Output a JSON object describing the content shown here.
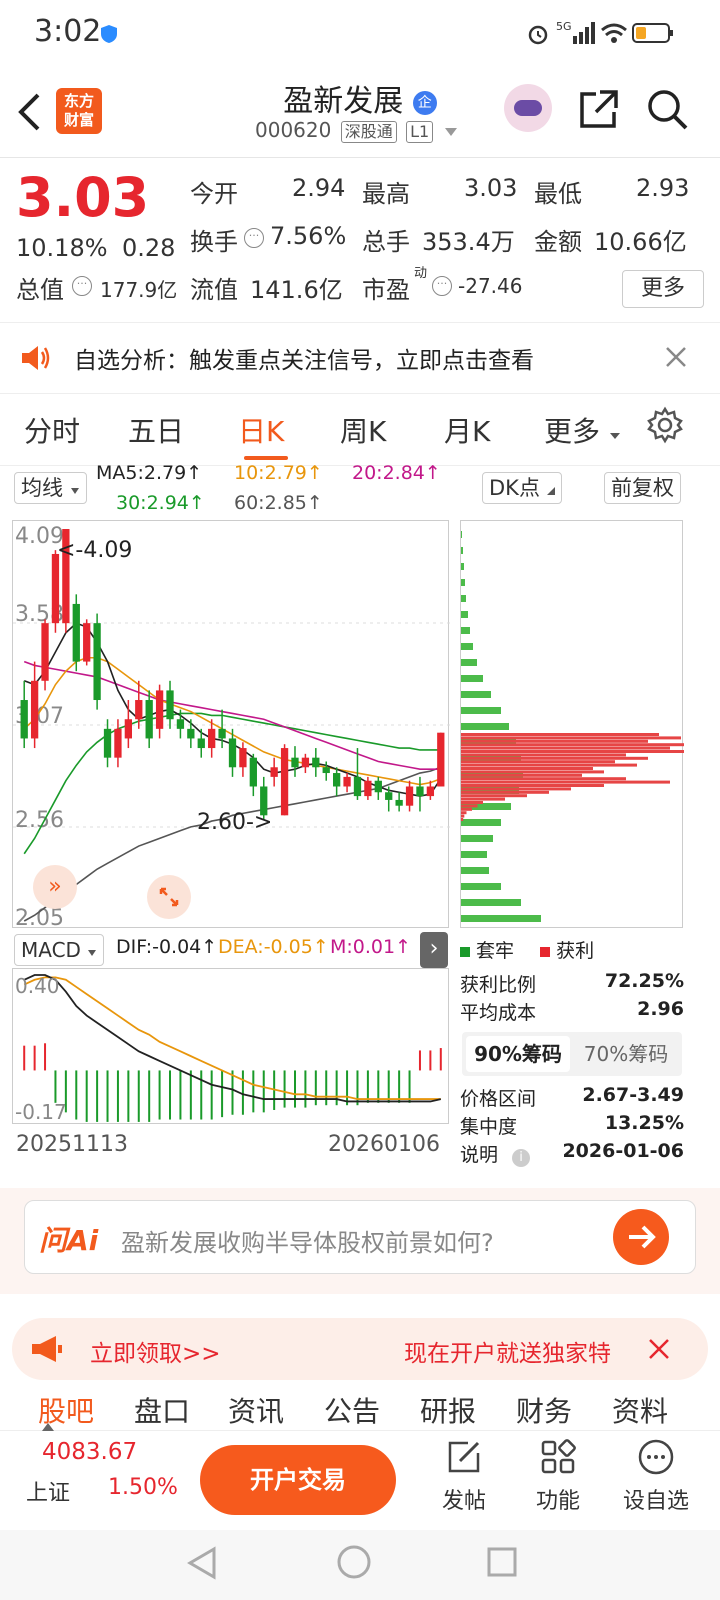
{
  "status": {
    "time": "3:02",
    "network": "5G"
  },
  "header": {
    "logo_line1": "东方",
    "logo_line2": "财富",
    "stock_name": "盈新发展",
    "ent_badge": "企",
    "stock_code": "000620",
    "tag1": "深股通",
    "tag2": "L1"
  },
  "quote": {
    "price": "3.03",
    "change_pct": "10.18%",
    "change": "0.28",
    "open_label": "今开",
    "open": "2.94",
    "high_label": "最高",
    "high": "3.03",
    "low_label": "最低",
    "low": "2.93",
    "turnover_label": "换手",
    "turnover": "7.56%",
    "volume_label": "总手",
    "volume": "353.4万",
    "amount_label": "金额",
    "amount": "10.66亿",
    "mktcap_label": "总值",
    "mktcap": "177.9亿",
    "float_label": "流值",
    "float": "141.6亿",
    "pe_label": "市盈",
    "pe_sup": "动",
    "pe": "-27.46",
    "more": "更多"
  },
  "notice": {
    "text": "自选分析：触发重点关注信号，立即点击查看"
  },
  "tabs": [
    "分时",
    "五日",
    "日K",
    "周K",
    "月K",
    "更多"
  ],
  "indicators": {
    "ma_select": "均线",
    "ma5": "MA5:2.79",
    "ma10": "10:2.79",
    "ma20": "20:2.84",
    "ma30": "30:2.94",
    "ma60": "60:2.85",
    "dk": "DK点",
    "adjust": "前复权"
  },
  "kline": {
    "y_ticks": [
      "4.09",
      "3.58",
      "3.07",
      "2.56",
      "2.05"
    ],
    "max_label": "<-4.09",
    "min_label": "2.60->",
    "macd_select": "MACD",
    "dif": "DIF:-0.04",
    "dea": "DEA:-0.05",
    "m": "M:0.01",
    "macd_ticks": [
      "0.40",
      "-0.17"
    ],
    "date_start": "20251113",
    "date_end": "20260106"
  },
  "chips": {
    "legend_trapped": "套牢",
    "legend_profit": "获利",
    "rows": [
      {
        "label": "获利比例",
        "value": "72.25%"
      },
      {
        "label": "平均成本",
        "value": "2.96"
      }
    ],
    "tab_90": "90%筹码",
    "tab_70": "70%筹码",
    "rows2": [
      {
        "label": "价格区间",
        "value": "2.67-3.49"
      },
      {
        "label": "集中度",
        "value": "13.25%"
      },
      {
        "label": "说明",
        "value": "2026-01-06"
      }
    ]
  },
  "ask": {
    "brand": "问Ai",
    "placeholder": "盈新发展收购半导体股权前景如何?"
  },
  "promo": {
    "left": "立即领取>>",
    "right": "现在开户就送独家特"
  },
  "subtabs": [
    "股吧",
    "盘口",
    "资讯",
    "公告",
    "研报",
    "财务",
    "资料"
  ],
  "bottom": {
    "index_value": "4083.67",
    "index_name": "上证",
    "index_pct": "1.50%",
    "trade": "开户交易",
    "post": "发帖",
    "func": "功能",
    "watch": "设自选"
  },
  "colors": {
    "red": "#e6262e",
    "green": "#1a9a2a",
    "orange": "#f25a1d",
    "gold": "#e8960c",
    "magenta": "#c2188a"
  },
  "chart_data": {
    "type": "candlestick",
    "categories_range": [
      "20251113",
      "20260106"
    ],
    "ylim": [
      2.05,
      4.09
    ],
    "candles": [
      {
        "o": 3.2,
        "c": 3.0,
        "h": 3.3,
        "l": 2.95
      },
      {
        "o": 3.0,
        "c": 3.3,
        "h": 3.4,
        "l": 2.95
      },
      {
        "o": 3.3,
        "c": 3.6,
        "h": 3.62,
        "l": 3.25
      },
      {
        "o": 3.6,
        "c": 3.96,
        "h": 3.98,
        "l": 3.55
      },
      {
        "o": 3.6,
        "c": 4.09,
        "h": 4.09,
        "l": 3.55
      },
      {
        "o": 3.7,
        "c": 3.4,
        "h": 3.75,
        "l": 3.35
      },
      {
        "o": 3.4,
        "c": 3.6,
        "h": 3.62,
        "l": 3.38
      },
      {
        "o": 3.6,
        "c": 3.2,
        "h": 3.65,
        "l": 3.15
      },
      {
        "o": 3.05,
        "c": 2.9,
        "h": 3.1,
        "l": 2.85
      },
      {
        "o": 2.9,
        "c": 3.05,
        "h": 3.1,
        "l": 2.85
      },
      {
        "o": 3.0,
        "c": 3.1,
        "h": 3.2,
        "l": 2.95
      },
      {
        "o": 3.1,
        "c": 3.2,
        "h": 3.3,
        "l": 3.05
      },
      {
        "o": 3.2,
        "c": 3.0,
        "h": 3.25,
        "l": 2.95
      },
      {
        "o": 3.05,
        "c": 3.25,
        "h": 3.28,
        "l": 3.0
      },
      {
        "o": 3.25,
        "c": 3.1,
        "h": 3.3,
        "l": 3.05
      },
      {
        "o": 3.1,
        "c": 3.05,
        "h": 3.15,
        "l": 3.0
      },
      {
        "o": 3.05,
        "c": 3.0,
        "h": 3.1,
        "l": 2.95
      },
      {
        "o": 3.0,
        "c": 2.95,
        "h": 3.05,
        "l": 2.9
      },
      {
        "o": 2.95,
        "c": 3.05,
        "h": 3.1,
        "l": 2.9
      },
      {
        "o": 3.05,
        "c": 3.0,
        "h": 3.15,
        "l": 2.95
      },
      {
        "o": 3.0,
        "c": 2.85,
        "h": 3.05,
        "l": 2.8
      },
      {
        "o": 2.85,
        "c": 2.95,
        "h": 2.98,
        "l": 2.8
      },
      {
        "o": 2.9,
        "c": 2.75,
        "h": 2.92,
        "l": 2.7
      },
      {
        "o": 2.75,
        "c": 2.6,
        "h": 2.8,
        "l": 2.58
      },
      {
        "o": 2.8,
        "c": 2.85,
        "h": 2.9,
        "l": 2.75
      },
      {
        "o": 2.6,
        "c": 2.95,
        "h": 2.97,
        "l": 2.6
      },
      {
        "o": 2.9,
        "c": 2.85,
        "h": 2.96,
        "l": 2.8
      },
      {
        "o": 2.85,
        "c": 2.9,
        "h": 2.92,
        "l": 2.82
      },
      {
        "o": 2.9,
        "c": 2.85,
        "h": 2.95,
        "l": 2.8
      },
      {
        "o": 2.85,
        "c": 2.82,
        "h": 2.88,
        "l": 2.78
      },
      {
        "o": 2.82,
        "c": 2.75,
        "h": 2.85,
        "l": 2.7
      },
      {
        "o": 2.75,
        "c": 2.8,
        "h": 2.82,
        "l": 2.72
      },
      {
        "o": 2.8,
        "c": 2.7,
        "h": 2.95,
        "l": 2.68
      },
      {
        "o": 2.7,
        "c": 2.78,
        "h": 2.8,
        "l": 2.68
      },
      {
        "o": 2.78,
        "c": 2.72,
        "h": 2.8,
        "l": 2.68
      },
      {
        "o": 2.72,
        "c": 2.68,
        "h": 2.75,
        "l": 2.62
      },
      {
        "o": 2.68,
        "c": 2.65,
        "h": 2.72,
        "l": 2.62
      },
      {
        "o": 2.65,
        "c": 2.75,
        "h": 2.78,
        "l": 2.62
      },
      {
        "o": 2.75,
        "c": 2.7,
        "h": 2.8,
        "l": 2.62
      },
      {
        "o": 2.7,
        "c": 2.75,
        "h": 2.78,
        "l": 2.68
      },
      {
        "o": 2.75,
        "c": 3.03,
        "h": 3.03,
        "l": 2.75
      }
    ],
    "ma5": [
      3.3,
      3.28,
      3.35,
      3.45,
      3.55,
      3.6,
      3.58,
      3.5,
      3.4,
      3.25,
      3.15,
      3.1,
      3.12,
      3.14,
      3.15,
      3.12,
      3.08,
      3.03,
      3.0,
      2.99,
      2.97,
      2.94,
      2.9,
      2.84,
      2.82,
      2.83,
      2.84,
      2.86,
      2.87,
      2.86,
      2.84,
      2.82,
      2.8,
      2.77,
      2.75,
      2.73,
      2.72,
      2.71,
      2.7,
      2.71,
      2.79
    ],
    "ma10": [
      3.05,
      3.1,
      3.18,
      3.28,
      3.35,
      3.4,
      3.42,
      3.42,
      3.4,
      3.36,
      3.32,
      3.28,
      3.24,
      3.2,
      3.18,
      3.16,
      3.14,
      3.11,
      3.08,
      3.05,
      3.02,
      2.99,
      2.96,
      2.93,
      2.91,
      2.89,
      2.88,
      2.87,
      2.86,
      2.85,
      2.84,
      2.83,
      2.82,
      2.81,
      2.8,
      2.79,
      2.78,
      2.77,
      2.76,
      2.77,
      2.79
    ],
    "ma20": [
      3.4,
      3.38,
      3.37,
      3.36,
      3.35,
      3.34,
      3.33,
      3.32,
      3.3,
      3.28,
      3.26,
      3.24,
      3.22,
      3.2,
      3.19,
      3.18,
      3.17,
      3.16,
      3.15,
      3.14,
      3.13,
      3.12,
      3.11,
      3.1,
      3.08,
      3.06,
      3.04,
      3.02,
      3.0,
      2.98,
      2.96,
      2.94,
      2.92,
      2.9,
      2.88,
      2.87,
      2.86,
      2.85,
      2.84,
      2.84,
      2.84
    ],
    "ma30": [
      2.4,
      2.48,
      2.58,
      2.68,
      2.78,
      2.86,
      2.93,
      2.98,
      3.02,
      3.05,
      3.07,
      3.09,
      3.1,
      3.11,
      3.12,
      3.13,
      3.13,
      3.13,
      3.12,
      3.12,
      3.11,
      3.1,
      3.09,
      3.08,
      3.07,
      3.06,
      3.05,
      3.04,
      3.03,
      3.02,
      3.01,
      3.0,
      2.99,
      2.98,
      2.97,
      2.96,
      2.95,
      2.95,
      2.94,
      2.94,
      2.94
    ],
    "ma60": [
      2.05,
      2.08,
      2.12,
      2.16,
      2.2,
      2.24,
      2.28,
      2.32,
      2.35,
      2.38,
      2.41,
      2.44,
      2.46,
      2.48,
      2.5,
      2.52,
      2.54,
      2.55,
      2.57,
      2.58,
      2.6,
      2.61,
      2.62,
      2.63,
      2.64,
      2.65,
      2.66,
      2.67,
      2.68,
      2.69,
      2.7,
      2.71,
      2.72,
      2.73,
      2.74,
      2.76,
      2.78,
      2.8,
      2.82,
      2.83,
      2.85
    ],
    "macd": {
      "ylim": [
        -0.17,
        0.4
      ],
      "dif": [
        0.38,
        0.4,
        0.4,
        0.38,
        0.33,
        0.27,
        0.23,
        0.2,
        0.17,
        0.14,
        0.11,
        0.08,
        0.06,
        0.04,
        0.02,
        0.0,
        -0.02,
        -0.04,
        -0.06,
        -0.07,
        -0.08,
        -0.1,
        -0.11,
        -0.12,
        -0.12,
        -0.12,
        -0.12,
        -0.12,
        -0.12,
        -0.12,
        -0.12,
        -0.13,
        -0.13,
        -0.13,
        -0.13,
        -0.13,
        -0.13,
        -0.13,
        -0.13,
        -0.13,
        -0.12
      ],
      "dea": [
        0.36,
        0.38,
        0.39,
        0.39,
        0.38,
        0.35,
        0.32,
        0.29,
        0.26,
        0.23,
        0.2,
        0.17,
        0.15,
        0.12,
        0.1,
        0.08,
        0.06,
        0.04,
        0.02,
        0.0,
        -0.02,
        -0.04,
        -0.06,
        -0.07,
        -0.08,
        -0.09,
        -0.1,
        -0.1,
        -0.11,
        -0.11,
        -0.11,
        -0.11,
        -0.12,
        -0.12,
        -0.12,
        -0.12,
        -0.12,
        -0.12,
        -0.12,
        -0.12,
        -0.12
      ],
      "m": [
        0.02,
        0.02,
        0.03,
        -0.01,
        -0.05,
        -0.08,
        -0.09,
        -0.09,
        -0.09,
        -0.09,
        -0.09,
        -0.09,
        -0.09,
        -0.08,
        -0.08,
        -0.08,
        -0.08,
        -0.08,
        -0.08,
        -0.07,
        -0.06,
        -0.06,
        -0.05,
        -0.05,
        -0.04,
        -0.03,
        -0.03,
        -0.03,
        -0.02,
        -0.02,
        -0.02,
        -0.02,
        -0.02,
        -0.01,
        -0.01,
        -0.01,
        -0.01,
        -0.01,
        0.0,
        0.0,
        0.01
      ]
    },
    "chips_trapped": [
      1,
      2,
      3,
      4,
      5,
      7,
      9,
      12,
      16,
      22,
      30,
      40,
      48,
      55,
      60,
      62,
      58,
      50,
      40,
      32,
      26,
      28,
      40,
      60,
      80,
      50
    ],
    "chips_profit": [
      180,
      200,
      170,
      220,
      190,
      210,
      150,
      170,
      140,
      160,
      120,
      130,
      110,
      150,
      190,
      130,
      100,
      80,
      60,
      40,
      20,
      15,
      10,
      5,
      3,
      2
    ]
  }
}
